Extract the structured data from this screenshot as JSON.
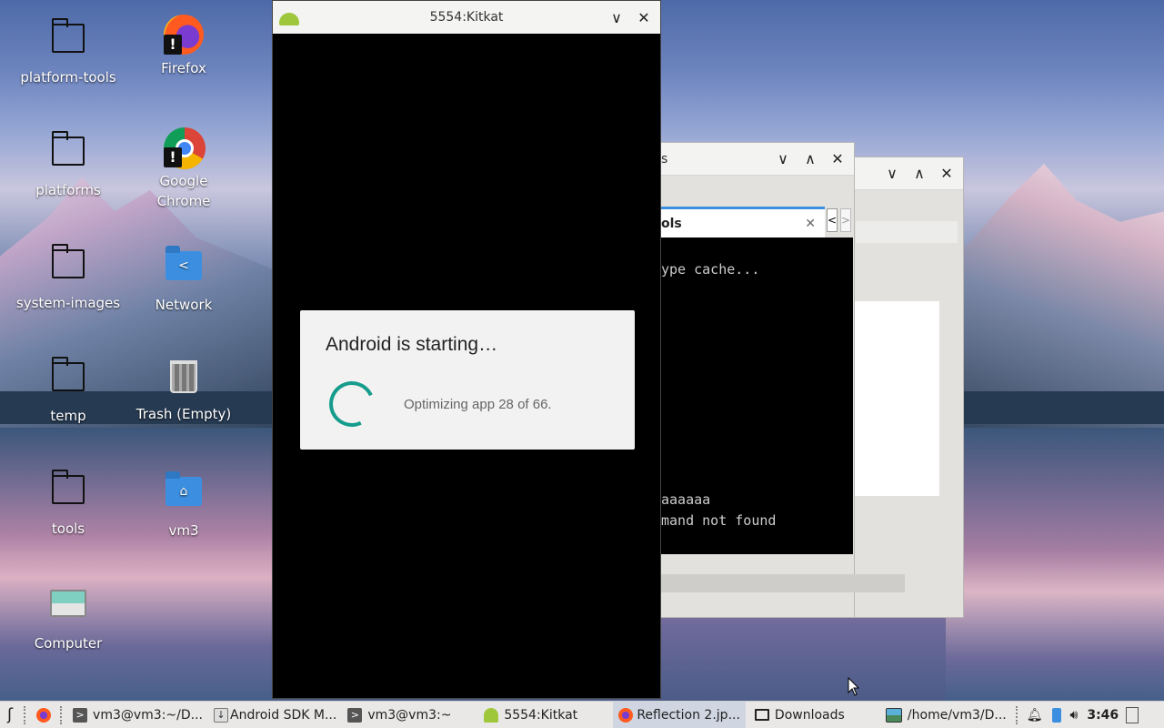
{
  "desktop": {
    "icons": [
      {
        "label": "platform-tools",
        "icon": "folder-icon"
      },
      {
        "label": "Firefox",
        "icon": "firefox-icon"
      },
      {
        "label": "platforms",
        "icon": "folder-icon"
      },
      {
        "label": "Google Chrome",
        "icon": "chrome-icon"
      },
      {
        "label": "system-images",
        "icon": "folder-icon"
      },
      {
        "label": "Network",
        "icon": "network-folder-icon"
      },
      {
        "label": "temp",
        "icon": "folder-icon"
      },
      {
        "label": "Trash (Empty)",
        "icon": "trash-icon"
      },
      {
        "label": "tools",
        "icon": "folder-icon"
      },
      {
        "label": "vm3",
        "icon": "home-folder-icon"
      },
      {
        "label": "Computer",
        "icon": "computer-icon"
      }
    ]
  },
  "emulator": {
    "title": "5554:Kitkat",
    "dialog": {
      "title": "Android is starting…",
      "message": "Optimizing app 28 of 66."
    }
  },
  "back_window_1": {
    "title_fragment": "s",
    "tab_label_fragment": "ols",
    "terminal_lines": [
      "ype cache...",
      "aaaaaa",
      "mand not found"
    ]
  },
  "taskbar": {
    "items": [
      {
        "label": "vm3@vm3:~/D...",
        "icon": "terminal-icon"
      },
      {
        "label": "Android SDK M...",
        "icon": "download-icon"
      },
      {
        "label": "vm3@vm3:~",
        "icon": "terminal-icon"
      },
      {
        "label": "5554:Kitkat",
        "icon": "android-icon"
      },
      {
        "label": "Reflection 2.jp...",
        "icon": "firefox-icon",
        "active": true
      },
      {
        "label": "Downloads",
        "icon": "folder-icon"
      },
      {
        "label": "/home/vm3/D...",
        "icon": "image-viewer-icon"
      }
    ],
    "clock": "3:46"
  },
  "colors": {
    "spinner": "#169c8c",
    "android_green": "#9fc73c",
    "taskbar_active": "#cfd6e2"
  }
}
